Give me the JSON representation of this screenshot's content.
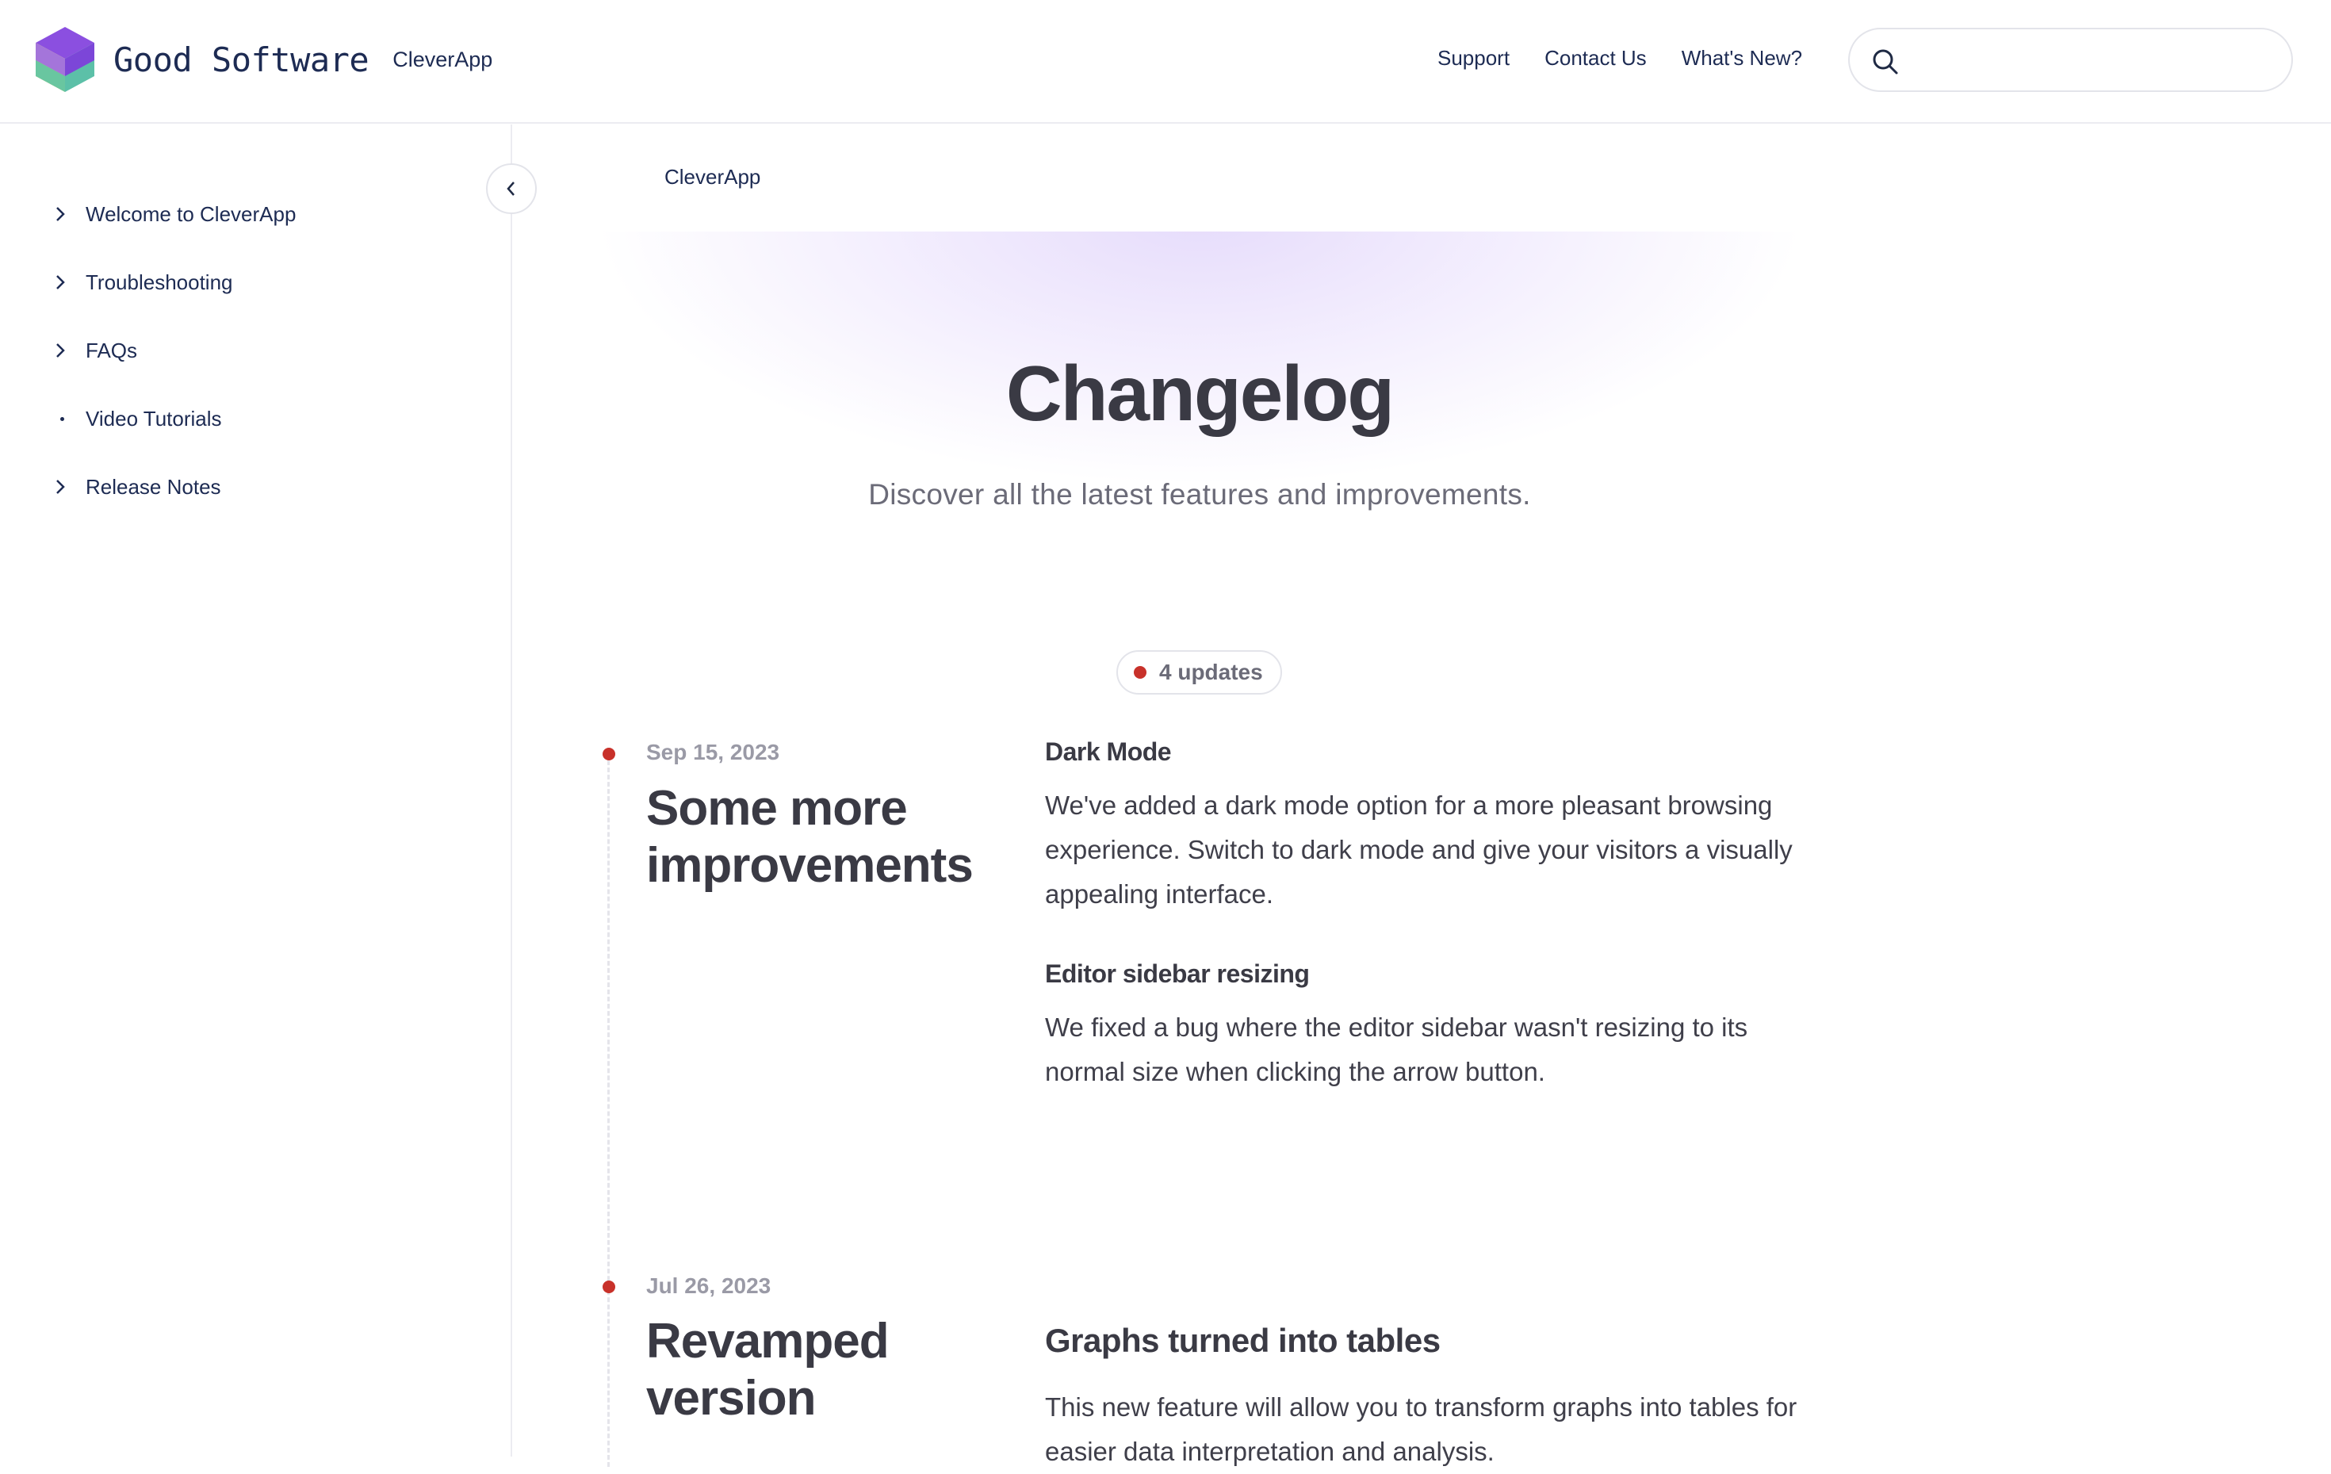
{
  "header": {
    "brand_name": "Good Software",
    "product_name": "CleverApp",
    "nav": [
      "Support",
      "Contact Us",
      "What's New?"
    ],
    "search_placeholder": ""
  },
  "sidebar": {
    "items": [
      {
        "label": "Welcome to CleverApp",
        "icon": "chevron-right-icon"
      },
      {
        "label": "Troubleshooting",
        "icon": "chevron-right-icon"
      },
      {
        "label": "FAQs",
        "icon": "chevron-right-icon"
      },
      {
        "label": "Video Tutorials",
        "icon": "bullet-dot-icon"
      },
      {
        "label": "Release Notes",
        "icon": "chevron-right-icon"
      }
    ],
    "collapse_icon": "chevron-left-icon"
  },
  "main": {
    "breadcrumb": "CleverApp",
    "title": "Changelog",
    "subtitle": "Discover all the latest features and improvements.",
    "badge": "4 updates",
    "entries": [
      {
        "date": "Sep 15, 2023",
        "title": "Some more improvements",
        "items": [
          {
            "heading": "Dark Mode",
            "body": "We've added a dark mode option for a more pleasant browsing experience. Switch to dark mode and give your visitors a visually appealing interface."
          },
          {
            "heading": "Editor sidebar resizing",
            "body": "We fixed a bug where the editor sidebar wasn't resizing to its normal size when clicking the arrow button."
          }
        ]
      },
      {
        "date": "Jul 26, 2023",
        "title": "Revamped version",
        "items": [
          {
            "heading": "Graphs turned into tables",
            "body": "This new feature will allow you to transform graphs into tables for easier data interpretation and analysis."
          }
        ]
      }
    ]
  },
  "colors": {
    "accent_dot": "#c8312a",
    "brand_text": "#1d2b53",
    "hero_glow": "#e6dcfb",
    "logo_purple": "#8b4fe0",
    "logo_teal": "#5cc0a8",
    "logo_yellow": "#f2c94c"
  }
}
